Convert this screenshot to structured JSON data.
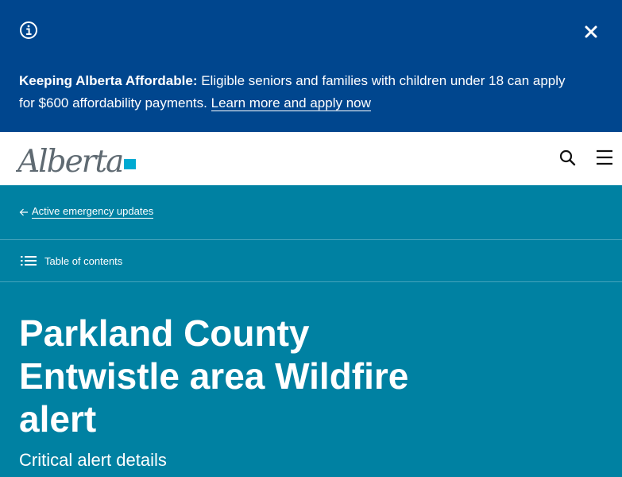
{
  "notice": {
    "heading": "Keeping Alberta Affordable:",
    "text": " Eligible seniors and families with children under 18 can apply for $600 affordability payments. ",
    "link_label": "Learn more and apply now"
  },
  "header": {
    "logo_text": "Alberta"
  },
  "breadcrumb": {
    "label": "Active emergency updates"
  },
  "toc": {
    "label": "Table of contents"
  },
  "page": {
    "title": "Parkland County Entwistle area Wildfire alert",
    "subtitle": "Critical alert details"
  },
  "colors": {
    "banner": "#00468e",
    "teal": "#0081a2",
    "logo_gray": "#5f6a72",
    "logo_accent": "#00aad2"
  }
}
